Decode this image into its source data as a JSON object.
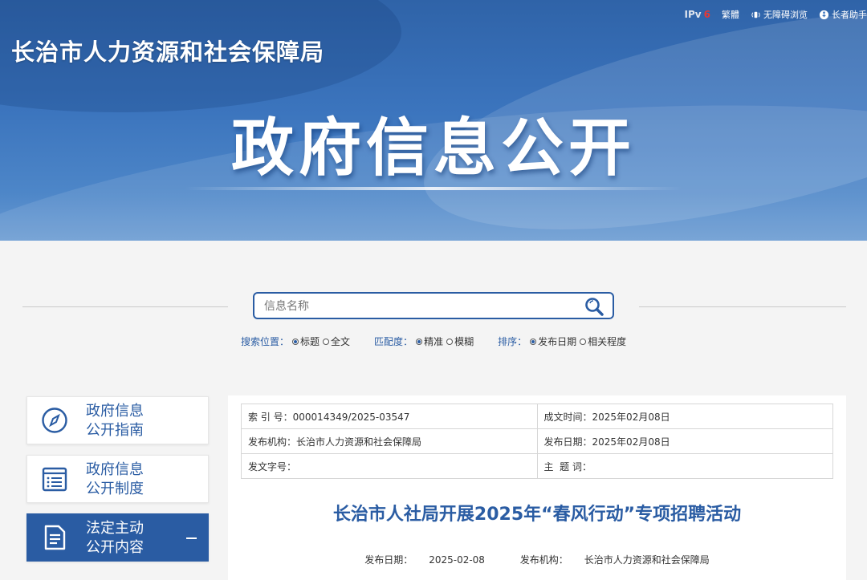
{
  "topbar": {
    "ipv6_prefix": "IPv",
    "ipv6_suffix": "6",
    "traditional": "繁體",
    "accessible": "无障碍浏览",
    "elderly": "长者助手"
  },
  "header": {
    "site_title": "长治市人力资源和社会保障局",
    "banner_title": "政府信息公开"
  },
  "search": {
    "placeholder": "信息名称",
    "position": {
      "label": "搜索位置：",
      "options": [
        "标题",
        "全文"
      ],
      "selected": "标题"
    },
    "match": {
      "label": "匹配度：",
      "options": [
        "精准",
        "模糊"
      ],
      "selected": "精准"
    },
    "sort": {
      "label": "排序：",
      "options": [
        "发布日期",
        "相关程度"
      ],
      "selected": "发布日期"
    }
  },
  "sidebar": {
    "items": [
      {
        "line1": "政府信息",
        "line2": "公开指南",
        "icon": "compass-icon",
        "active": false
      },
      {
        "line1": "政府信息",
        "line2": "公开制度",
        "icon": "list-document-icon",
        "active": false
      },
      {
        "line1": "法定主动",
        "line2": "公开内容",
        "icon": "document-icon",
        "active": true
      }
    ]
  },
  "meta": {
    "index_label": "索 引 号：",
    "index_value": "000014349/2025-03547",
    "created_label": "成文时间：",
    "created_value": "2025年02月08日",
    "publisher_label": "发布机构：",
    "publisher_value": "长治市人力资源和社会保障局",
    "pubdate_label": "发布日期：",
    "pubdate_value": "2025年02月08日",
    "docno_label": "发文字号：",
    "docno_value": "",
    "subject_label": "主  题 词：",
    "subject_value": ""
  },
  "article": {
    "title": "长治市人社局开展2025年“春风行动”专项招聘活动",
    "date_label": "发布日期：",
    "date_value": "2025-02-08",
    "org_label": "发布机构：",
    "org_value": "长治市人力资源和社会保障局"
  },
  "colors": {
    "primary": "#2a5ca3",
    "ipv6_accent": "#e53935"
  }
}
